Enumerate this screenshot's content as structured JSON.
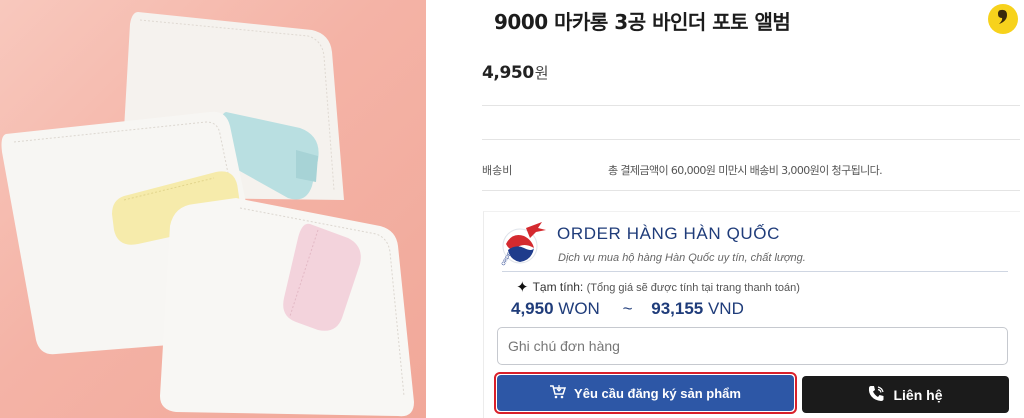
{
  "product": {
    "title": "9000 마카롱 3공 바인더 포토 앨범",
    "price_value": "4,950",
    "price_unit": "원"
  },
  "shipping": {
    "label": "배송비",
    "text": "총 결제금액이 60,000원 미만시 배송비 3,000원이 청구됩니다."
  },
  "order": {
    "title": "ORDER HÀNG HÀN QUỐC",
    "subtitle": "Dịch vụ mua hộ hàng Hàn Quốc uy tín, chất lượng.",
    "estimate_label": "Tạm tính:",
    "estimate_note": "(Tổng giá sẽ được tính tại trang thanh toán)",
    "won_value": "4,950",
    "won_unit": "WON",
    "approx": "~",
    "vnd_value": "93,155",
    "vnd_unit": "VND",
    "note_placeholder": "Ghi chú đơn hàng",
    "register_label": "Yêu cầu đăng ký sản phẩm",
    "contact_label": "Liên hệ"
  },
  "colors": {
    "brand_blue": "#2d57a6",
    "highlight_red": "#d9202a",
    "kakao_yellow": "#f7d21c",
    "contact_black": "#1b1b1b"
  },
  "icons": [
    "kakao-chat-icon",
    "order-logo-icon",
    "sparkle-icon",
    "cart-icon",
    "phone-icon"
  ]
}
